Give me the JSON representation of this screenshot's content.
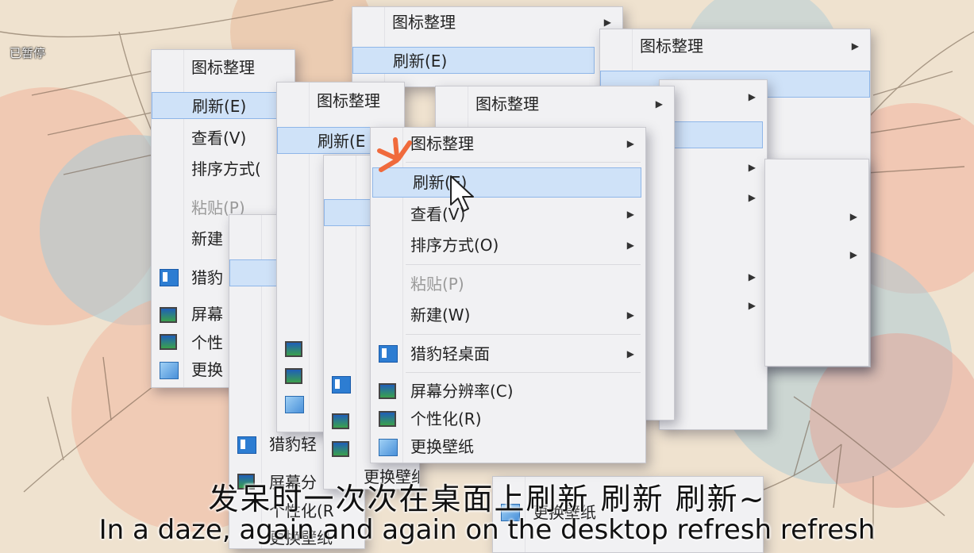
{
  "status": {
    "paused_label": "已暂停"
  },
  "menu": {
    "items": [
      {
        "id": "arrange",
        "label": "图标整理",
        "submenu": true
      },
      {
        "id": "refresh",
        "label": "刷新(E)",
        "submenu": false,
        "highlighted": true
      },
      {
        "id": "view",
        "label": "查看(V)",
        "submenu": true
      },
      {
        "id": "sort",
        "label": "排序方式(O)",
        "submenu": true
      },
      {
        "id": "paste",
        "label": "粘贴(P)",
        "submenu": false,
        "disabled": true
      },
      {
        "id": "new",
        "label": "新建(W)",
        "submenu": true
      },
      {
        "id": "cheetah",
        "label": "猎豹轻桌面",
        "submenu": true,
        "icon": "panel-icon"
      },
      {
        "id": "resolution",
        "label": "屏幕分辨率(C)",
        "submenu": false,
        "icon": "monitor-icon"
      },
      {
        "id": "personalize",
        "label": "个性化(R)",
        "submenu": false,
        "icon": "monitor-color-icon"
      },
      {
        "id": "wallpaper",
        "label": "更换壁纸",
        "submenu": false,
        "icon": "picture-icon"
      }
    ],
    "fragments": {
      "new_short": "新建",
      "cheetah_short": "猎豹",
      "screen_short": "屏幕",
      "personal_short": "个性",
      "change_short": "更换",
      "cheetah_mid": "猎豹轻",
      "screen_mid": "屏幕分",
      "personal_mid": "个性化(R",
      "refresh_cut": "刷新(E",
      "sort_cut": "排序方式(",
      "paste_cut": "粘贴(P)"
    }
  },
  "subtitle": {
    "cn": "发呆时一次次在桌面上刷新 刷新 刷新~",
    "en": "In a daze, again and again on the desktop refresh refresh"
  },
  "colors": {
    "highlight": "#cfe2f8",
    "highlight_border": "#8fb6e8",
    "menu_bg": "#f1f1f3"
  }
}
